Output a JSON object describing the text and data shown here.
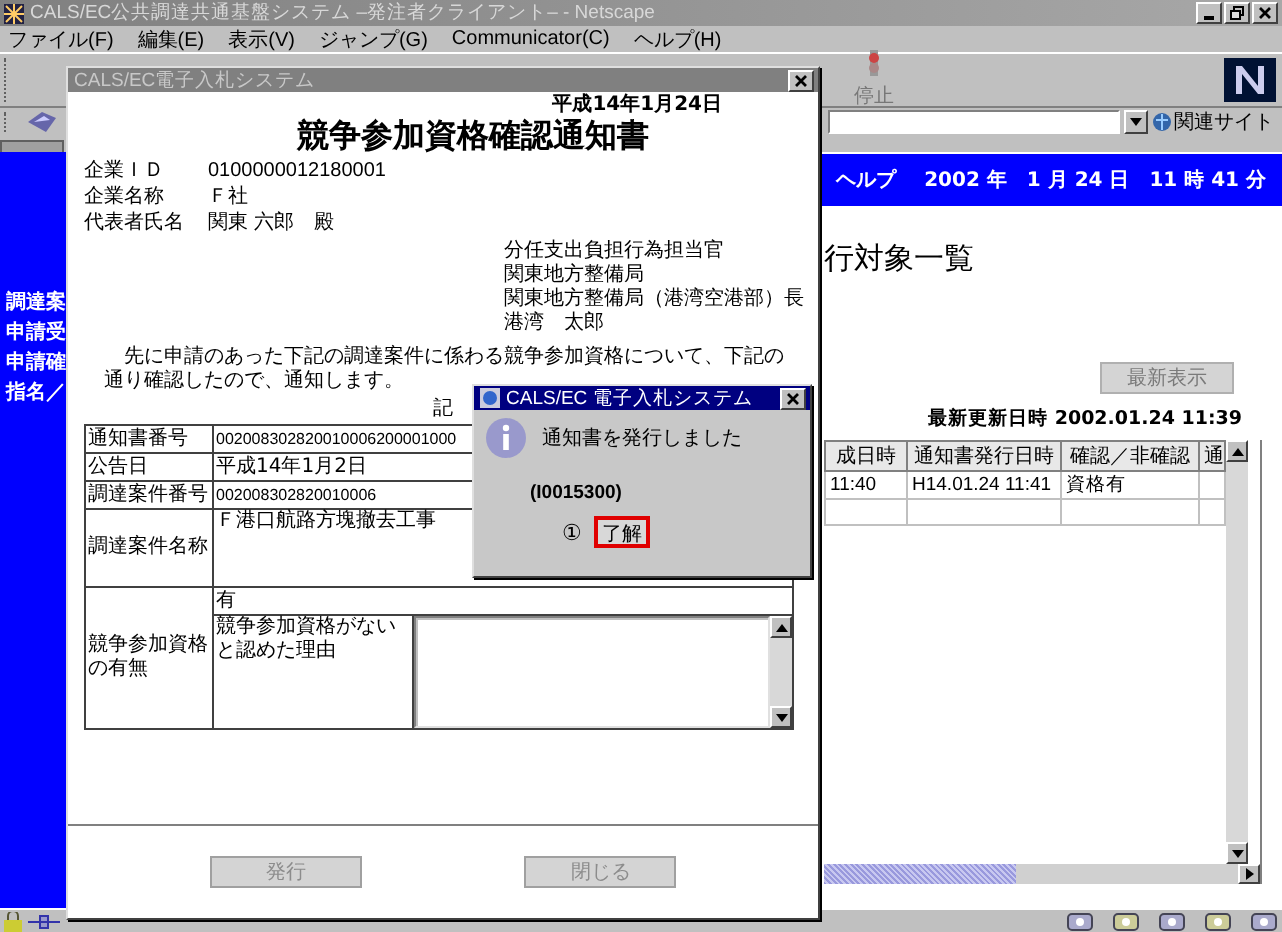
{
  "browser": {
    "title": "CALS/EC公共調達共通基盤システム –発注者クライアント– - Netscape",
    "active": false,
    "menu": [
      "ファイル(F)",
      "編集(E)",
      "表示(V)",
      "ジャンプ(G)",
      "Communicator(C)",
      "ヘルプ(H)"
    ],
    "toolbar": {
      "stop_label": "停止"
    },
    "location": {
      "related_sites": "関連サイト"
    }
  },
  "page": {
    "banner": {
      "help": "ヘルプ",
      "datetime": "2002 年　1 月 24 日　11 時 41 分"
    },
    "sidebar": [
      "調達案",
      "申請受",
      "申請確",
      "指名／"
    ],
    "heading": "行対象一覧",
    "refresh_button": {
      "label": "最新表示",
      "disabled": true
    },
    "last_updated": "最新更新日時 2002.01.24 11:39",
    "table": {
      "columns": [
        "成日時",
        "通知書発行日時",
        "確認／非確認",
        "通"
      ],
      "rows": [
        {
          "cells": [
            "11:40",
            "H14.01.24 11:41",
            "資格有"
          ]
        }
      ]
    }
  },
  "notice_window": {
    "title": "CALS/EC電子入札システム",
    "active": false,
    "date": "平成14年1月24日",
    "heading": "競争参加資格確認通知書",
    "fields": [
      {
        "label": "企業ＩＤ",
        "value": "0100000012180001"
      },
      {
        "label": "企業名称",
        "value": "Ｆ社"
      },
      {
        "label": "代表者氏名",
        "value": "関東 六郎　殿"
      }
    ],
    "sender": [
      "分任支出負担行為担当官",
      "関東地方整備局",
      "関東地方整備局（港湾空港部）長",
      "港湾　太郎"
    ],
    "body": "先に申請のあった下記の調達案件に係わる競争参加資格について、下記の通り確認したので、通知します。",
    "note_mark": "記",
    "rows": [
      {
        "label": "通知書番号",
        "value": "002008302820010006200001000"
      },
      {
        "label": "公告日",
        "value": "平成14年1月2日"
      },
      {
        "label": "調達案件番号",
        "value": "002008302820010006"
      },
      {
        "label": "調達案件名称",
        "value": "Ｆ港口航路方塊撤去工事"
      }
    ],
    "qualification": {
      "label": "競争参加資格の有無",
      "value": "有",
      "reason_label": "競争参加資格がないと認めた理由"
    },
    "buttons": [
      {
        "label": "発行",
        "disabled": true
      },
      {
        "label": "閉じる",
        "disabled": true
      }
    ]
  },
  "dialog": {
    "title": "CALS/EC 電子入札システム",
    "active": true,
    "message": "通知書を発行しました",
    "code": "(I0015300)",
    "callout": "①",
    "ok_button": {
      "label": "了解",
      "highlighted": true
    }
  }
}
